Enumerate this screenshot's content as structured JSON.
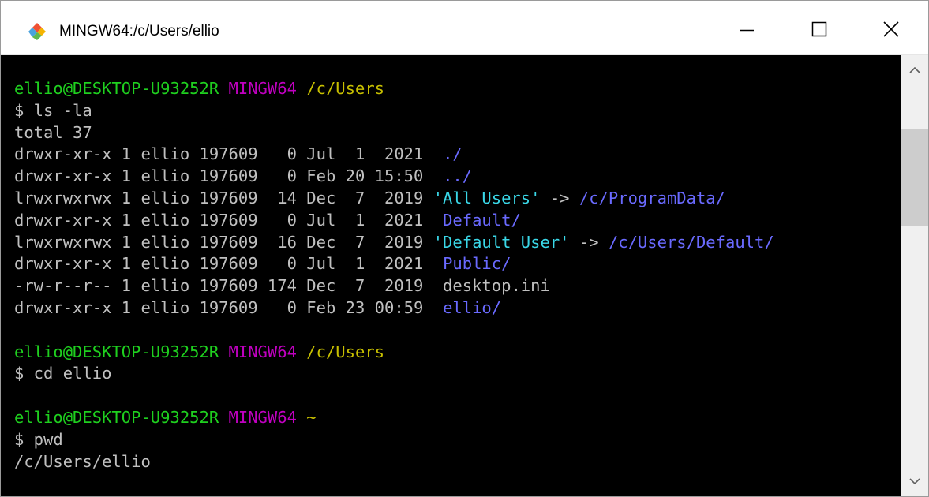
{
  "window": {
    "title": "MINGW64:/c/Users/ellio",
    "app_icon": "git-bash-icon",
    "controls": [
      "minimize-icon",
      "maximize-icon",
      "close-icon"
    ]
  },
  "colors": {
    "prompt_user": "#1fd01f",
    "prompt_env": "#c000c0",
    "prompt_path": "#c8c000",
    "directory": "#6a6aff",
    "symlink": "#3ad8e8",
    "default_text": "#c0c0c0",
    "background": "#000000"
  },
  "terminal": {
    "lines": [
      [
        {
          "t": "ellio@DESKTOP-U93252R",
          "c": "green"
        },
        {
          "t": " "
        },
        {
          "t": "MINGW64",
          "c": "magenta"
        },
        {
          "t": " "
        },
        {
          "t": "/c/Users",
          "c": "yellow"
        }
      ],
      [
        {
          "t": "$ ls -la"
        }
      ],
      [
        {
          "t": "total 37"
        }
      ],
      [
        {
          "t": "drwxr-xr-x 1 ellio 197609   0 Jul  1  2021  "
        },
        {
          "t": "./",
          "c": "blue"
        }
      ],
      [
        {
          "t": "drwxr-xr-x 1 ellio 197609   0 Feb 20 15:50  "
        },
        {
          "t": "../",
          "c": "blue"
        }
      ],
      [
        {
          "t": "lrwxrwxrwx 1 ellio 197609  14 Dec  7  2019 "
        },
        {
          "t": "'All Users'",
          "c": "cyan"
        },
        {
          "t": " -> "
        },
        {
          "t": "/c/ProgramData/",
          "c": "blue"
        }
      ],
      [
        {
          "t": "drwxr-xr-x 1 ellio 197609   0 Jul  1  2021  "
        },
        {
          "t": "Default/",
          "c": "blue"
        }
      ],
      [
        {
          "t": "lrwxrwxrwx 1 ellio 197609  16 Dec  7  2019 "
        },
        {
          "t": "'Default User'",
          "c": "cyan"
        },
        {
          "t": " -> "
        },
        {
          "t": "/c/Users/Default/",
          "c": "blue"
        }
      ],
      [
        {
          "t": "drwxr-xr-x 1 ellio 197609   0 Jul  1  2021  "
        },
        {
          "t": "Public/",
          "c": "blue"
        }
      ],
      [
        {
          "t": "-rw-r--r-- 1 ellio 197609 174 Dec  7  2019  desktop.ini"
        }
      ],
      [
        {
          "t": "drwxr-xr-x 1 ellio 197609   0 Feb 23 00:59  "
        },
        {
          "t": "ellio/",
          "c": "blue"
        }
      ],
      [],
      [
        {
          "t": "ellio@DESKTOP-U93252R",
          "c": "green"
        },
        {
          "t": " "
        },
        {
          "t": "MINGW64",
          "c": "magenta"
        },
        {
          "t": " "
        },
        {
          "t": "/c/Users",
          "c": "yellow"
        }
      ],
      [
        {
          "t": "$ cd ellio"
        }
      ],
      [],
      [
        {
          "t": "ellio@DESKTOP-U93252R",
          "c": "green"
        },
        {
          "t": " "
        },
        {
          "t": "MINGW64",
          "c": "magenta"
        },
        {
          "t": " "
        },
        {
          "t": "~",
          "c": "yellow"
        }
      ],
      [
        {
          "t": "$ pwd"
        }
      ],
      [
        {
          "t": "/c/Users/ellio"
        }
      ]
    ]
  },
  "scrollbar": {
    "up_icon": "scroll-up-arrow-icon",
    "down_icon": "scroll-down-arrow-icon"
  }
}
